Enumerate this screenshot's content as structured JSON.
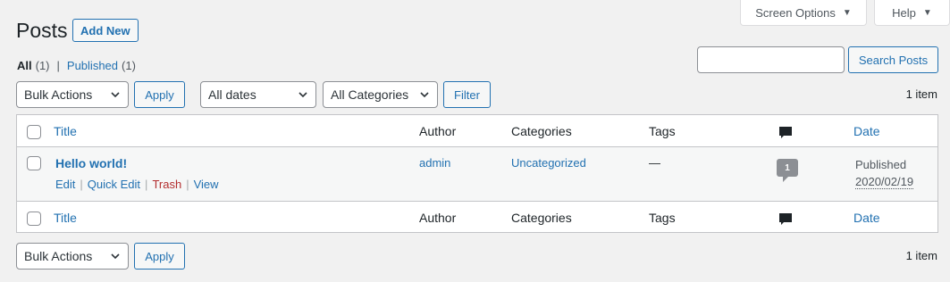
{
  "screen_meta": {
    "screen_options_label": "Screen Options",
    "help_label": "Help"
  },
  "header": {
    "title": "Posts",
    "add_new_label": "Add New"
  },
  "views": {
    "all_label": "All",
    "all_count": "(1)",
    "separator": "|",
    "published_label": "Published",
    "published_count": "(1)"
  },
  "search": {
    "input_value": "",
    "button_label": "Search Posts"
  },
  "top_nav": {
    "bulk_actions": "Bulk Actions",
    "apply_label": "Apply",
    "dates": "All dates",
    "categories": "All Categories",
    "filter_label": "Filter",
    "items_count": "1 item"
  },
  "columns": {
    "title": "Title",
    "author": "Author",
    "categories": "Categories",
    "tags": "Tags",
    "date": "Date"
  },
  "posts": [
    {
      "title": "Hello world!",
      "actions": {
        "edit": "Edit",
        "quick_edit": "Quick Edit",
        "trash": "Trash",
        "view": "View",
        "sep": "|"
      },
      "author": "admin",
      "category": "Uncategorized",
      "tags": "—",
      "comments": "1",
      "status": "Published",
      "date": "2020/02/19"
    }
  ],
  "bottom_nav": {
    "bulk_actions": "Bulk Actions",
    "apply_label": "Apply",
    "items_count": "1 item"
  },
  "colors": {
    "link": "#2271b1",
    "trash": "#b32d2e",
    "background": "#f1f1f1",
    "comment_bubble": "#8c8f94"
  }
}
